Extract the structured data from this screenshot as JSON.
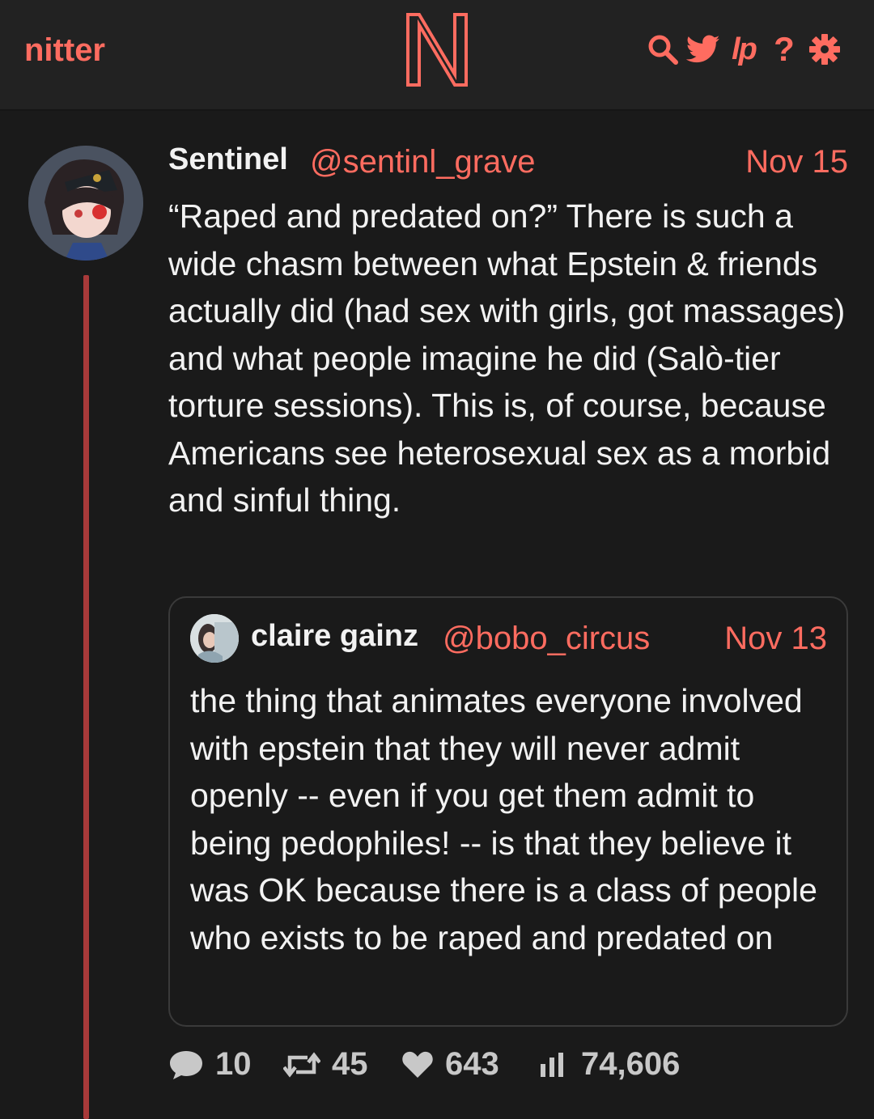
{
  "colors": {
    "accent": "#ff6c60",
    "background": "#1a1a1a",
    "thread_line": "#a83a3a"
  },
  "navbar": {
    "brand": "nitter",
    "logo_letter": "N",
    "icons": [
      "search-icon",
      "twitter-bird-icon",
      "rss-icon",
      "help-icon",
      "settings-gear-icon"
    ],
    "rss_label": "lp",
    "help_label": "?"
  },
  "tweet": {
    "fullname": "Sentinel",
    "username": "@sentinl_grave",
    "date": "Nov 15",
    "text": "“Raped and predated on?” There is such a wide chasm between what Epstein & friends actually did (had sex with girls, got massages) and what people imagine he did (Salò-tier torture sessions). This is, of course, because Americans see heterosexual sex as a morbid and sinful thing.",
    "quote": {
      "fullname": "claire gainz",
      "username": "@bobo_circus",
      "date": "Nov 13",
      "text": "the thing that animates everyone involved with epstein that they will never admit openly -- even if you get them admit to being pedophiles! -- is that they believe it was OK because there is a class of people who exists to be raped and predated on"
    },
    "stats": {
      "replies": "10",
      "retweets": "45",
      "likes": "643",
      "views": "74,606"
    }
  }
}
